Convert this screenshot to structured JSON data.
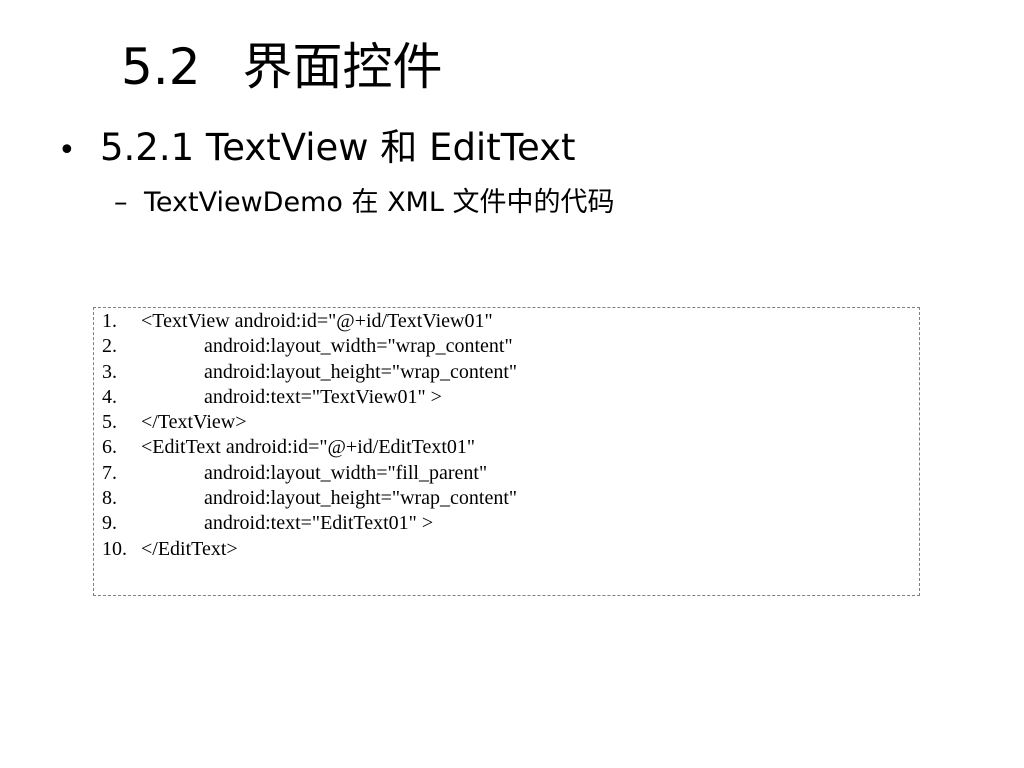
{
  "title": {
    "number": "5.2",
    "text": "界面控件"
  },
  "bullet": {
    "symbol": "•",
    "text": "5.2.1 TextView 和 EditText"
  },
  "sub_bullet": {
    "symbol": "–",
    "text": "TextViewDemo 在 XML 文件中的代码"
  },
  "code": {
    "lines": [
      {
        "num": "1.",
        "text": "<TextView android:id=\"@+id/TextView01\"",
        "indent": false
      },
      {
        "num": "2.",
        "text": "android:layout_width=\"wrap_content\"",
        "indent": true
      },
      {
        "num": "3.",
        "text": "android:layout_height=\"wrap_content\"",
        "indent": true
      },
      {
        "num": "4.",
        "text": "android:text=\"TextView01\" >",
        "indent": true
      },
      {
        "num": "5.",
        "text": "</TextView>",
        "indent": false
      },
      {
        "num": "6.",
        "text": "<EditText android:id=\"@+id/EditText01\"",
        "indent": false
      },
      {
        "num": "7.",
        "text": "android:layout_width=\"fill_parent\"",
        "indent": true
      },
      {
        "num": "8.",
        "text": "android:layout_height=\"wrap_content\"",
        "indent": true
      },
      {
        "num": "9.",
        "text": "android:text=\"EditText01\" >",
        "indent": true
      },
      {
        "num": "10.",
        "text": "</EditText>",
        "indent": false
      }
    ]
  }
}
